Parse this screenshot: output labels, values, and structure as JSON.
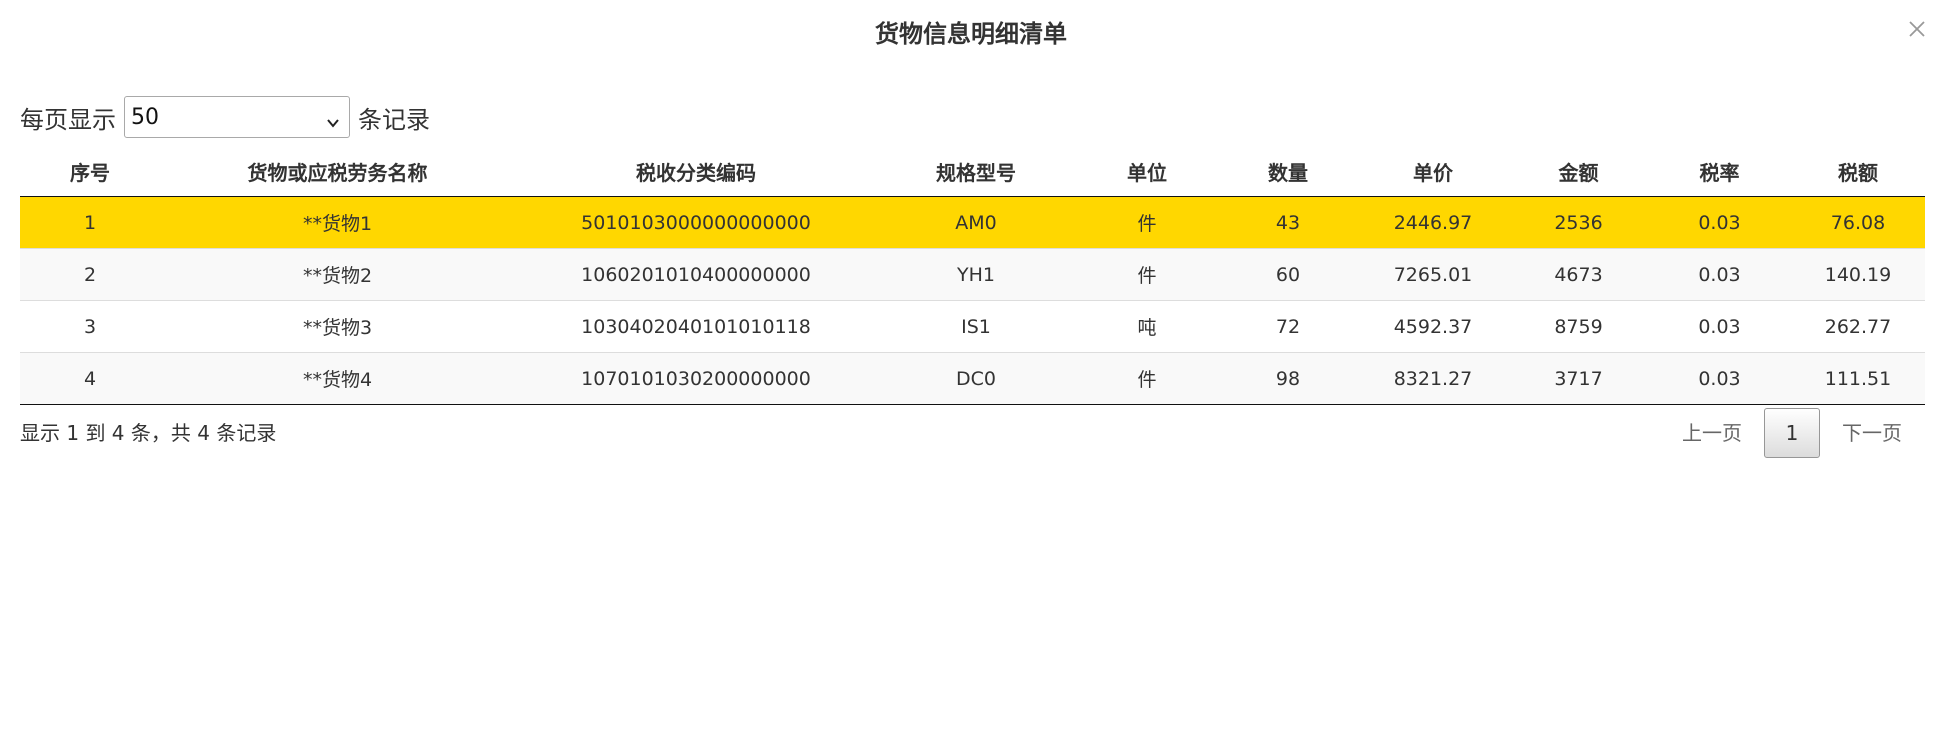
{
  "dialog": {
    "title": "货物信息明细清单",
    "close_icon": "close-icon"
  },
  "length_menu": {
    "prefix": "每页显示",
    "selected": "50",
    "suffix": "条记录",
    "arrow_icon": "chevron-down-icon"
  },
  "table": {
    "headers": [
      "序号",
      "货物或应税劳务名称",
      "税收分类编码",
      "规格型号",
      "单位",
      "数量",
      "单价",
      "金额",
      "税率",
      "税额"
    ],
    "rows": [
      [
        "1",
        "**货物1",
        "5010103000000000000",
        "AM0",
        "件",
        "43",
        "2446.97",
        "2536",
        "0.03",
        "76.08"
      ],
      [
        "2",
        "**货物2",
        "1060201010400000000",
        "YH1",
        "件",
        "60",
        "7265.01",
        "4673",
        "0.03",
        "140.19"
      ],
      [
        "3",
        "**货物3",
        "1030402040101010118",
        "IS1",
        "吨",
        "72",
        "4592.37",
        "8759",
        "0.03",
        "262.77"
      ],
      [
        "4",
        "**货物4",
        "1070101030200000000",
        "DC0",
        "件",
        "98",
        "8321.27",
        "3717",
        "0.03",
        "111.51"
      ]
    ],
    "selected_row_index": 0
  },
  "footer": {
    "info": "显示 1 到 4 条，共 4 条记录",
    "prev_label": "上一页",
    "current_page": "1",
    "next_label": "下一页"
  },
  "colors": {
    "selected_row": "#ffd700",
    "striped_row": "#f9f9f9",
    "text": "#333333"
  }
}
